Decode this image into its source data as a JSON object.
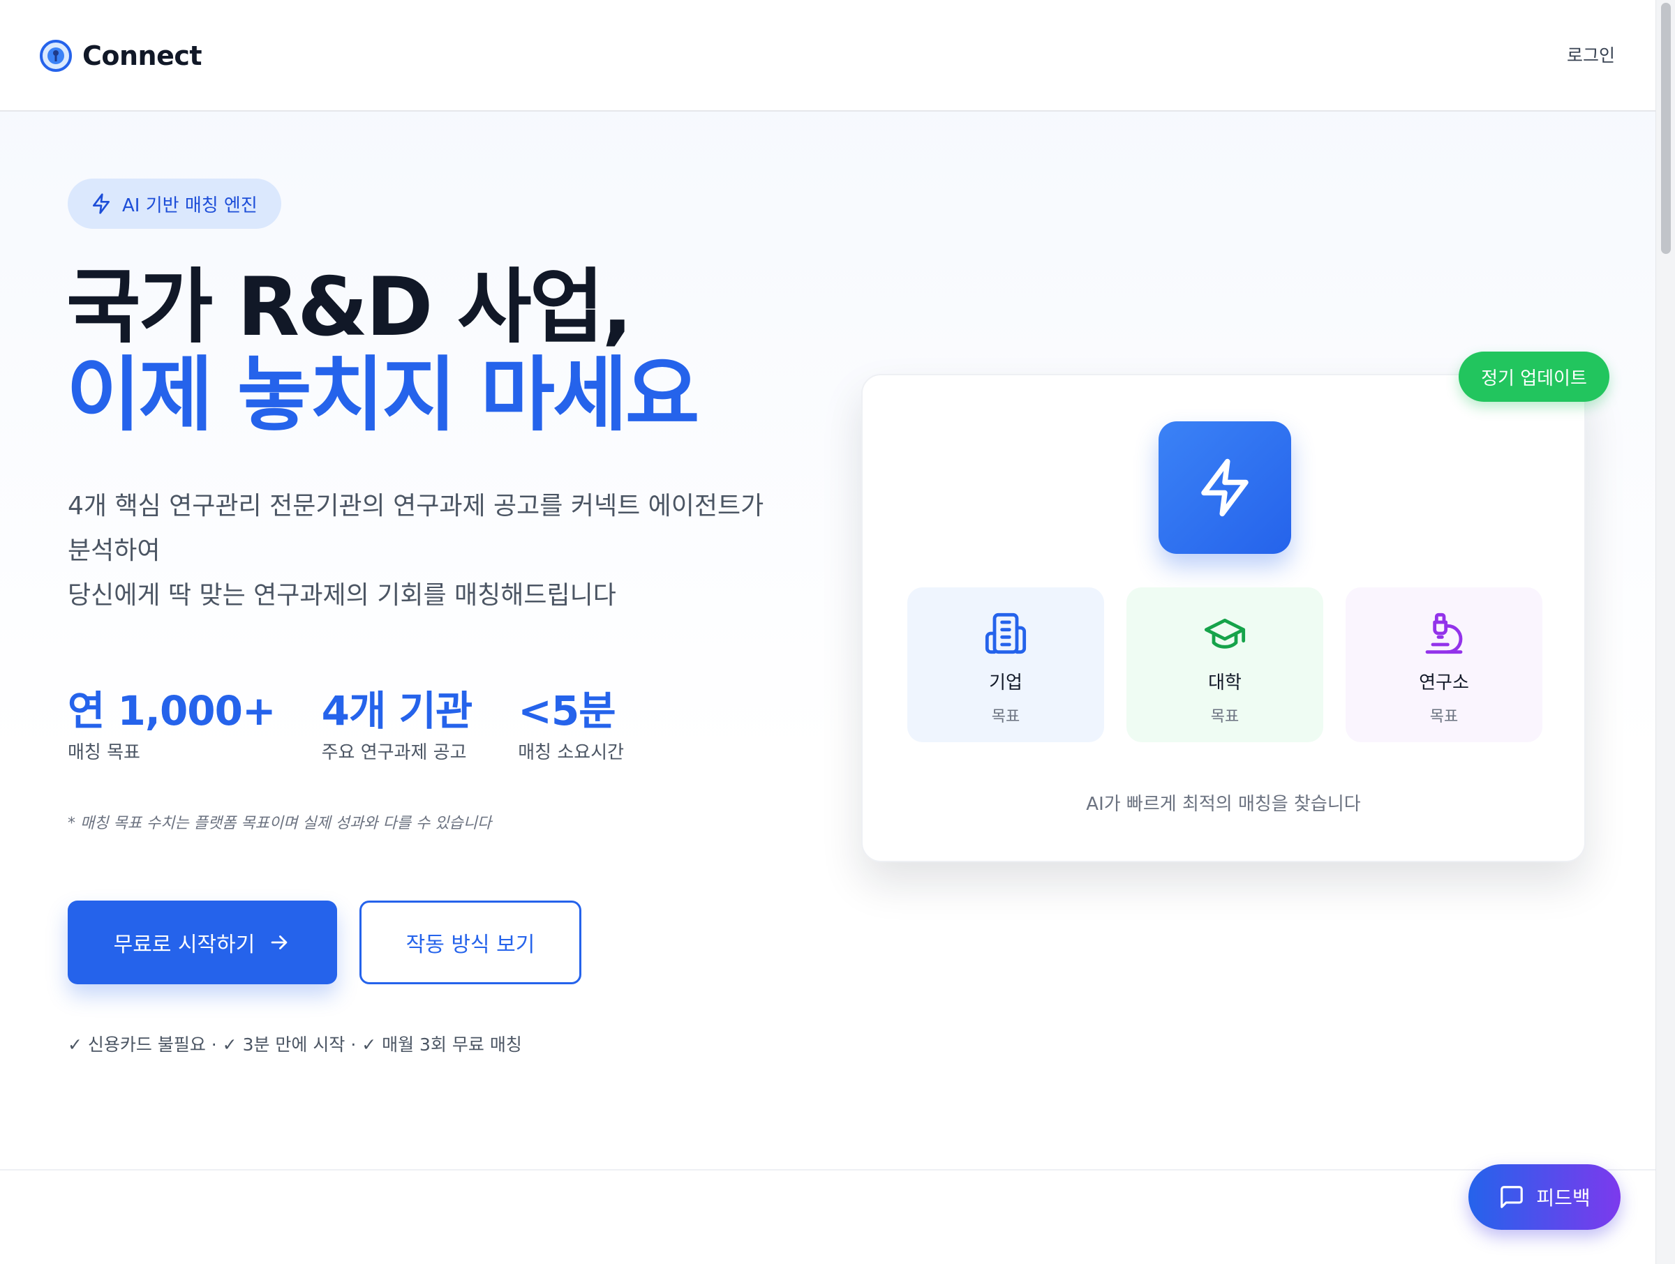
{
  "header": {
    "brand": "Connect",
    "login_label": "로그인"
  },
  "hero": {
    "badge": "AI 기반 매칭 엔진",
    "headline_line1": "국가 R&D 사업,",
    "headline_line2": "이제 놓치지 마세요",
    "description_lines": [
      "4개 핵심 연구관리 전문기관의 연구과제 공고를 커넥트 에이전트가",
      "분석하여",
      "당신에게 딱 맞는 연구과제의 기회를 매칭해드립니다"
    ],
    "stats": [
      {
        "value": "연 1,000+",
        "label": "매칭 목표"
      },
      {
        "value": "4개 기관",
        "label": "주요 연구과제 공고"
      },
      {
        "value": "<5분",
        "label": "매칭 소요시간"
      }
    ],
    "disclaimer": "* 매칭 목표 수치는 플랫폼 목표이며 실제 성과와 다를 수 있습니다",
    "primary_button": "무료로 시작하기",
    "secondary_button": "작동 방식 보기",
    "checks": "✓ 신용카드 불필요 · ✓ 3분 만에 시작 · ✓ 매월 3회 무료 매칭"
  },
  "card": {
    "update_badge": "정기 업데이트",
    "targets": [
      {
        "label": "기업",
        "sub": "목표",
        "icon": "building-icon",
        "color": "#2563eb"
      },
      {
        "label": "대학",
        "sub": "목표",
        "icon": "graduation-cap-icon",
        "color": "#16a34a"
      },
      {
        "label": "연구소",
        "sub": "목표",
        "icon": "microscope-icon",
        "color": "#9333ea"
      }
    ],
    "caption": "AI가 빠르게 최적의 매칭을 찾습니다"
  },
  "feedback": {
    "label": "피드백"
  },
  "colors": {
    "accent": "#2563eb",
    "success": "#22c55e",
    "text_dark": "#111827"
  }
}
